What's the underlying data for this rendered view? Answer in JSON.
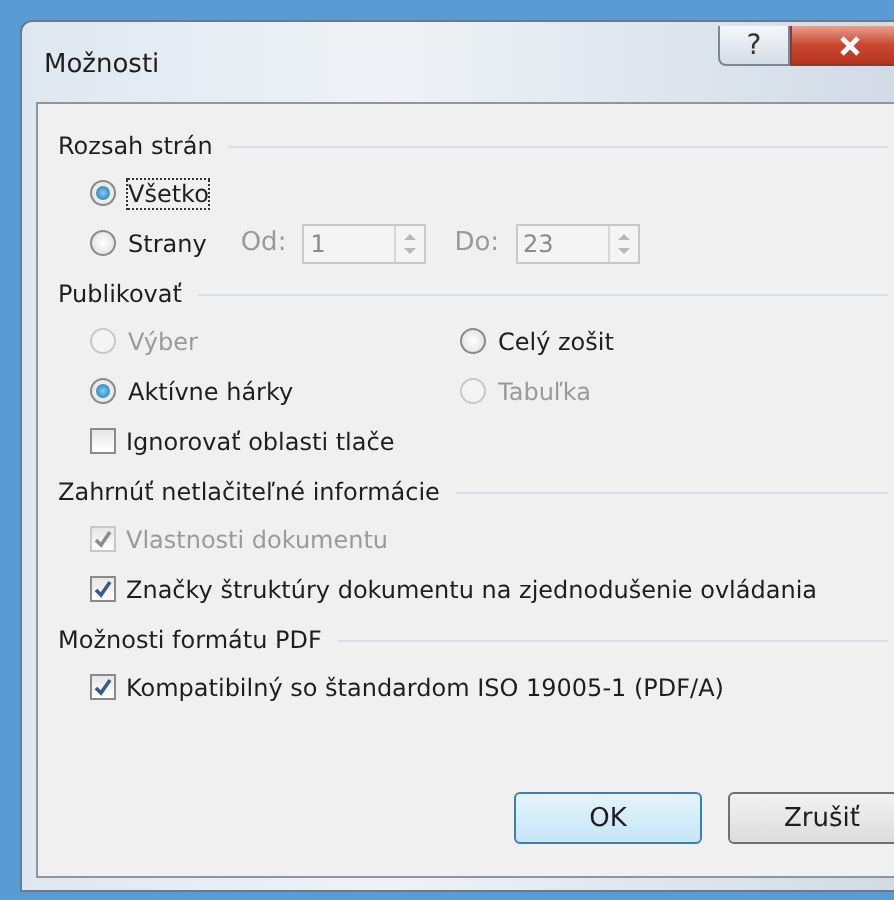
{
  "window": {
    "title": "Možnosti",
    "help": "?"
  },
  "page_range": {
    "title": "Rozsah strán",
    "options": [
      {
        "label": "Všetko",
        "selected": true,
        "focused": true
      },
      {
        "label": "Strany",
        "selected": false,
        "focused": false
      }
    ],
    "from": {
      "label": "Od:",
      "value": "1",
      "disabled": true
    },
    "to": {
      "label": "Do:",
      "value": "23",
      "disabled": true
    }
  },
  "publish": {
    "title": "Publikovať",
    "options": [
      {
        "label": "Výber",
        "selected": false,
        "disabled": true
      },
      {
        "label": "Celý zošit",
        "selected": false,
        "disabled": false
      },
      {
        "label": "Aktívne hárky",
        "selected": true,
        "disabled": false
      },
      {
        "label": "Tabuľka",
        "selected": false,
        "disabled": true
      }
    ],
    "checkboxes": [
      {
        "label": "Ignorovať oblasti tlače",
        "checked": false,
        "disabled": false
      }
    ]
  },
  "non_printing": {
    "title": "Zahrnúť netlačiteľné informácie",
    "checkboxes": [
      {
        "label": "Vlastnosti dokumentu",
        "checked": true,
        "disabled": true
      },
      {
        "label": "Značky štruktúry dokumentu na zjednodušenie ovládania",
        "checked": true,
        "disabled": false
      }
    ]
  },
  "pdf_options": {
    "title": "Možnosti formátu PDF",
    "checkboxes": [
      {
        "label": "Kompatibilný so štandardom ISO 19005-1 (PDF/A)",
        "checked": true,
        "disabled": false
      }
    ]
  },
  "buttons": [
    {
      "label": "OK",
      "default": true
    },
    {
      "label": "Zrušiť",
      "default": false
    }
  ]
}
